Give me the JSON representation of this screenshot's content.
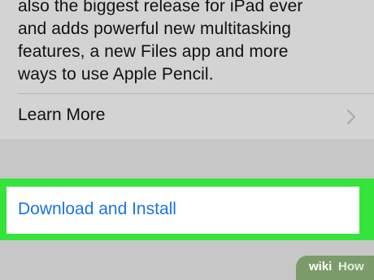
{
  "description": {
    "lines": [
      "also the biggest release for iPad ever",
      "and adds powerful new multitasking",
      "features, a new Files app and more",
      "ways to use Apple Pencil."
    ]
  },
  "learn_more": {
    "label": "Learn More",
    "icon": "chevron-right-icon"
  },
  "download": {
    "label": "Download and Install"
  },
  "watermark": {
    "wiki": "wiki",
    "how": "How"
  },
  "colors": {
    "link_blue": "#1a73e8",
    "highlight_green": "#35e43a",
    "background_gray": "#d3d3d3",
    "text_dark": "#111111"
  }
}
